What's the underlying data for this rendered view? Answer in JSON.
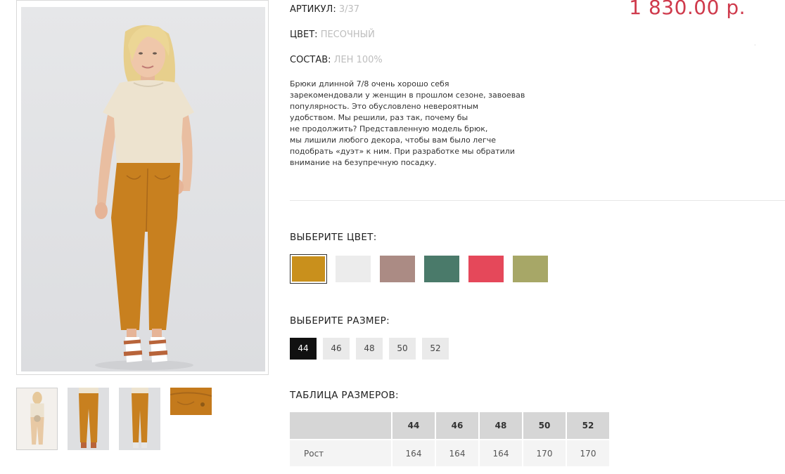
{
  "product": {
    "sku_label": "АРТИКУЛ:",
    "sku_value": "3/37",
    "color_label": "ЦВЕТ:",
    "color_value": "ПЕСОЧНЫЙ",
    "composition_label": "СОСТАВ:",
    "composition_value": "ЛЕН 100%",
    "price": "1 830.00 р.",
    "description_lines": [
      "Брюки длинной 7/8 очень хорошо себя",
      "зарекомендовали у женщин в прошлом сезоне, завоевав",
      "популярность. Это обусловлено невероятным",
      "удобством. Мы решили, раз так, почему бы",
      "не продолжить? Представленную модель брюк,",
      "мы лишили любого декора, чтобы вам было легче",
      "подобрать «дуэт» к ним. При разработке мы обратили",
      "внимание на безупречную посадку."
    ]
  },
  "choose_color": {
    "title": "ВЫБЕРИТЕ ЦВЕТ:",
    "swatches": [
      {
        "color": "#c9901c",
        "selected": true
      },
      {
        "color": "#ececec",
        "selected": false
      },
      {
        "color": "#ab8b84",
        "selected": false
      },
      {
        "color": "#4a7a6a",
        "selected": false
      },
      {
        "color": "#e5485a",
        "selected": false
      },
      {
        "color": "#a7a767",
        "selected": false
      }
    ]
  },
  "choose_size": {
    "title": "ВЫБЕРИТЕ РАЗМЕР:",
    "sizes": [
      "44",
      "46",
      "48",
      "50",
      "52"
    ],
    "selected": "44"
  },
  "size_table": {
    "title": "ТАБЛИЦА РАЗМЕРОВ:",
    "header": [
      "",
      "44",
      "46",
      "48",
      "50",
      "52"
    ],
    "rows": [
      [
        "Рост",
        "164",
        "164",
        "164",
        "170",
        "170"
      ]
    ]
  },
  "colors": {
    "price": "#cf3a4c",
    "pants": "#c8801f",
    "top": "#ede3cf",
    "photo_background": "#e2e3e5"
  },
  "gallery": {
    "main_image": "woman-orange-pants-photo",
    "thumbnails": [
      "front-thumb",
      "pants-front-thumb",
      "pants-side-thumb",
      "fabric-detail-thumb"
    ]
  }
}
